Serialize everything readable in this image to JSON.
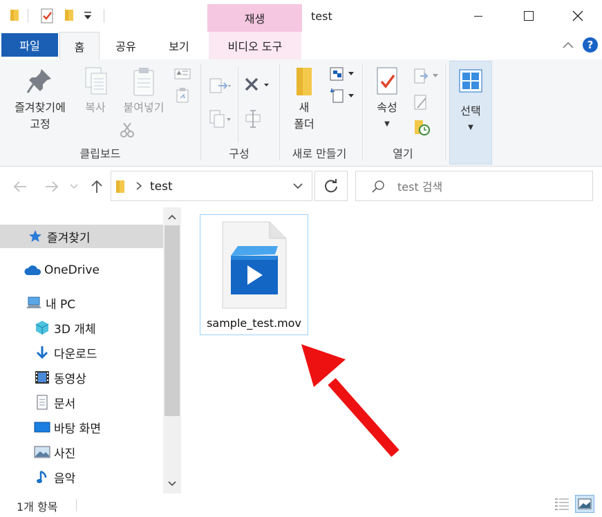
{
  "window": {
    "title": "test",
    "context_tab": "재생",
    "minimize": "minimize",
    "maximize": "maximize",
    "close": "close"
  },
  "tabs": {
    "file": "파일",
    "home": "홈",
    "share": "공유",
    "view": "보기",
    "video_tools": "비디오 도구"
  },
  "ribbon": {
    "pin_line1": "즐겨찾기에",
    "pin_line2": "고정",
    "copy": "복사",
    "paste": "붙여넣기",
    "clipboard_group": "클립보드",
    "organize_group": "구성",
    "new_folder_line1": "새",
    "new_folder_line2": "폴더",
    "new_group": "새로 만들기",
    "properties": "속성",
    "open_group": "열기",
    "select": "선택"
  },
  "address": {
    "path": "test",
    "search_placeholder": "test 검색"
  },
  "nav": {
    "quick_access": "즐겨찾기",
    "onedrive": "OneDrive",
    "this_pc": "내 PC",
    "objects_3d": "3D 개체",
    "downloads": "다운로드",
    "videos": "동영상",
    "documents": "문서",
    "desktop": "바탕 화면",
    "pictures": "사진",
    "music": "음악"
  },
  "files": [
    {
      "name": "sample_test.mov"
    }
  ],
  "status": {
    "count": "1개 항목"
  },
  "colors": {
    "file_tab": "#1a5fb4",
    "context_tab": "#f6c7e1",
    "selection_border": "#99d1ff",
    "arrow": "#ee1111"
  }
}
